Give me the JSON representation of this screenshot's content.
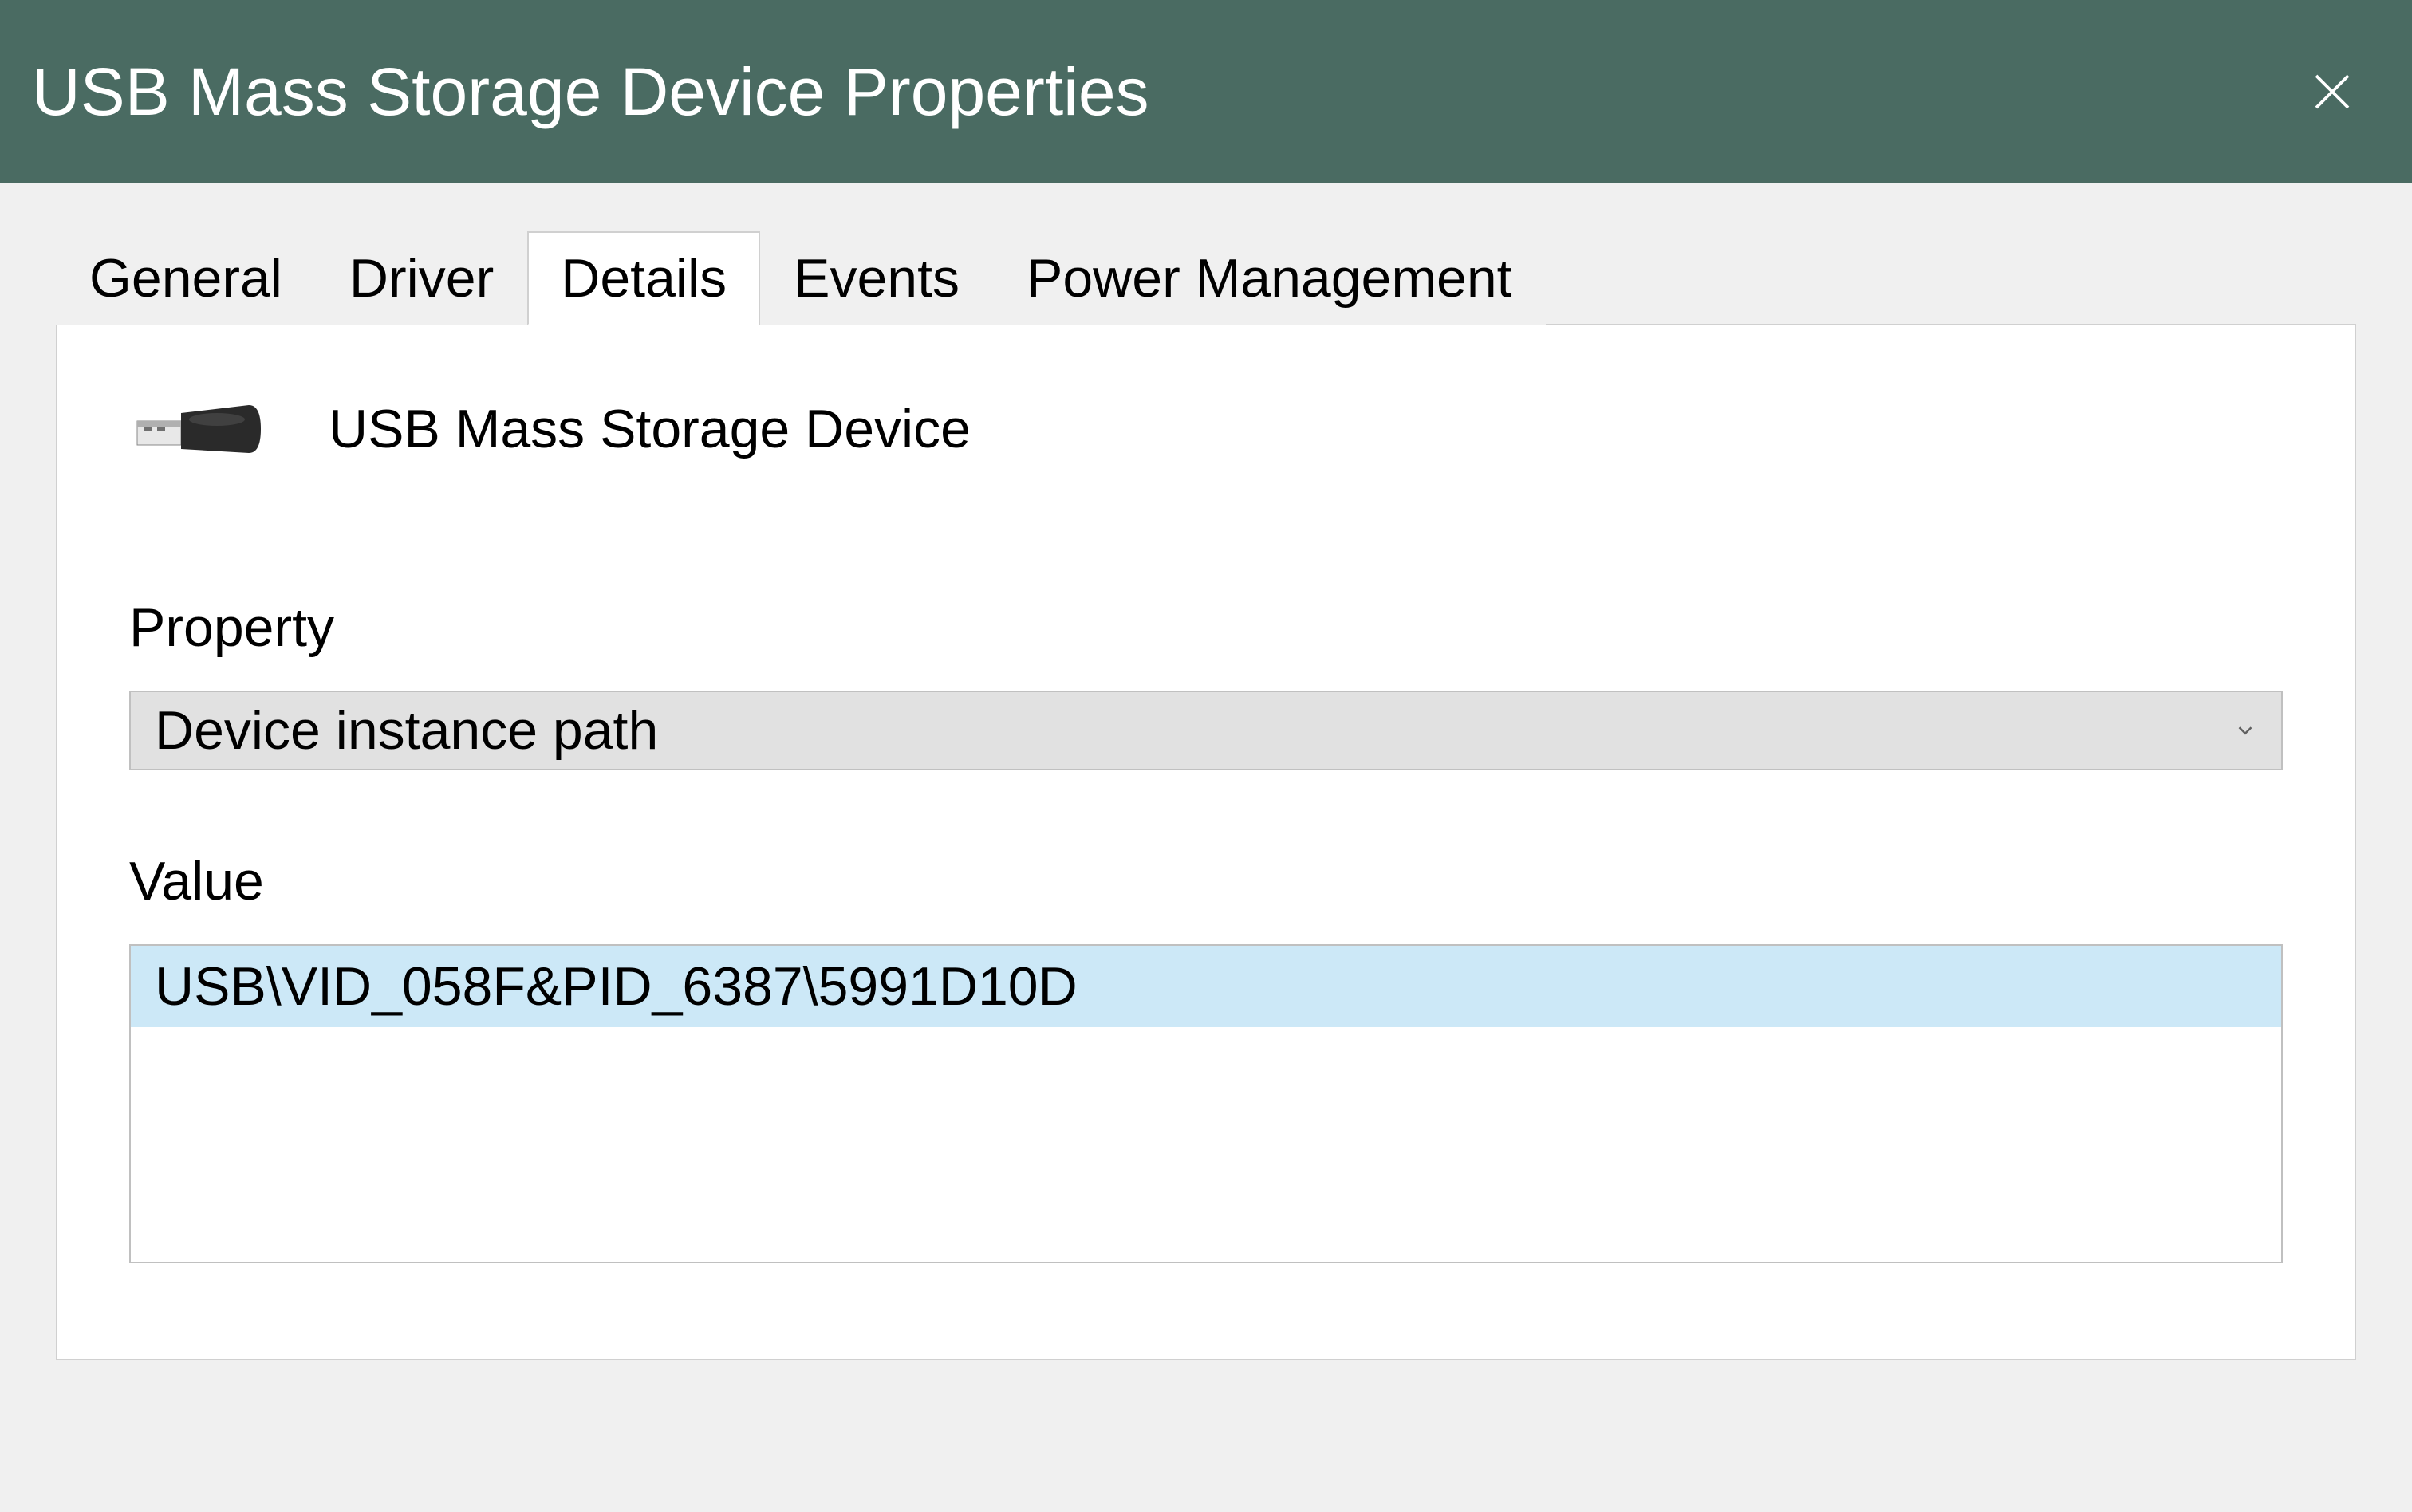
{
  "window": {
    "title": "USB Mass Storage Device Properties"
  },
  "tabs": {
    "general": "General",
    "driver": "Driver",
    "details": "Details",
    "events": "Events",
    "power_management": "Power Management",
    "active": "details"
  },
  "device": {
    "name": "USB Mass Storage Device"
  },
  "details": {
    "property_label": "Property",
    "property_selected": "Device instance path",
    "value_label": "Value",
    "value_text": "USB\\VID_058F&PID_6387\\5991D10D"
  }
}
